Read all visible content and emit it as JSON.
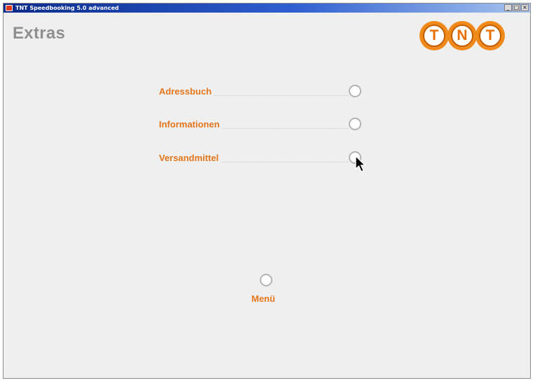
{
  "window": {
    "title": "TNT Speedbooking 5.0 advanced",
    "controls": [
      "_",
      "□",
      "×"
    ]
  },
  "page": {
    "title": "Extras"
  },
  "logo": {
    "letters": [
      "T",
      "N",
      "T"
    ],
    "icon": "tnt-logo",
    "color": "#f08a1a"
  },
  "menu": {
    "items": [
      {
        "label": "Adressbuch"
      },
      {
        "label": "Informationen"
      },
      {
        "label": "Versandmittel"
      }
    ]
  },
  "footer": {
    "menu_label": "Menü"
  },
  "colors": {
    "accent": "#e4761c",
    "title": "#8f8f8f",
    "background": "#efefef"
  }
}
